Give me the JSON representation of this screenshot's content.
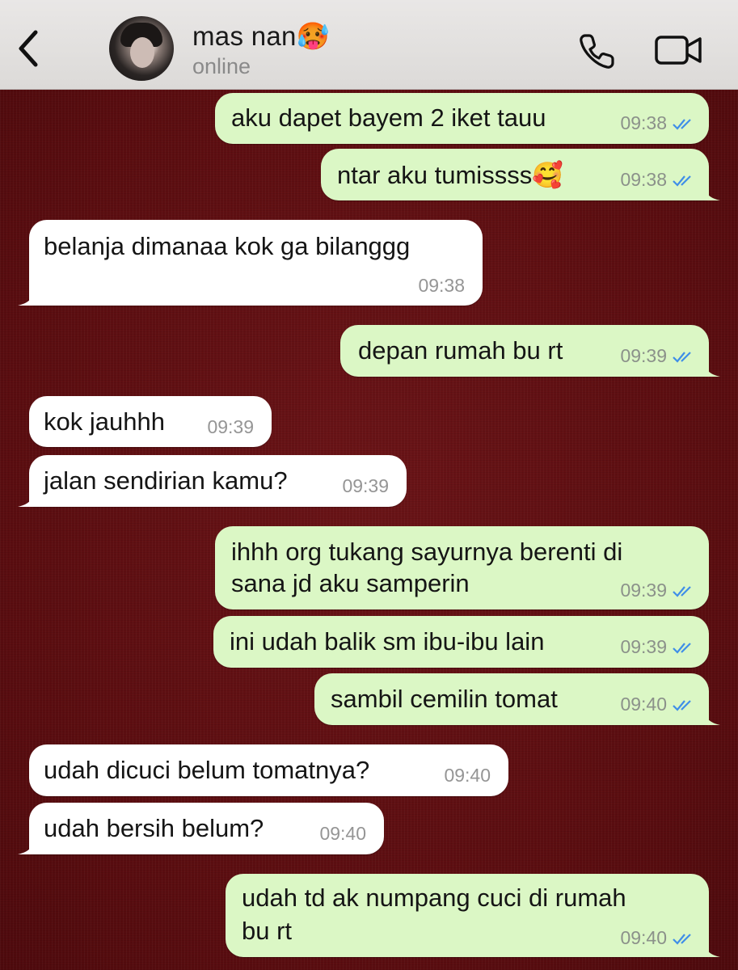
{
  "header": {
    "contact_name": "mas nan🥵",
    "status": "online"
  },
  "messages": [
    {
      "side": "out",
      "text": "aku dapet bayem 2 iket tauu",
      "time": "09:38"
    },
    {
      "side": "out",
      "text": "ntar aku tumissss🥰",
      "time": "09:38"
    },
    {
      "side": "in",
      "text": "belanja dimanaa kok ga bilanggg",
      "time": "09:38"
    },
    {
      "side": "out",
      "text": "depan rumah bu rt",
      "time": "09:39"
    },
    {
      "side": "in",
      "text": "kok jauhhh",
      "time": "09:39"
    },
    {
      "side": "in",
      "text": "jalan sendirian kamu?",
      "time": "09:39"
    },
    {
      "side": "out",
      "lines": [
        "ihhh org tukang sayurnya berenti di",
        "sana jd aku samperin"
      ],
      "time": "09:39"
    },
    {
      "side": "out",
      "text": "ini udah balik sm ibu-ibu lain",
      "time": "09:39"
    },
    {
      "side": "out",
      "text": "sambil cemilin tomat",
      "time": "09:40"
    },
    {
      "side": "in",
      "text": "udah dicuci belum tomatnya?",
      "time": "09:40"
    },
    {
      "side": "in",
      "text": "udah bersih belum?",
      "time": "09:40"
    },
    {
      "side": "out",
      "lines": [
        "udah td ak numpang cuci di rumah",
        "bu rt"
      ],
      "time": "09:40"
    }
  ],
  "colors": {
    "outgoing_bubble": "#dbf7c5",
    "incoming_bubble": "#ffffff",
    "read_ticks": "#3f8ee8",
    "chat_background": "#5e0f12"
  },
  "icons": {
    "back": "chevron-left-icon",
    "call": "phone-icon",
    "video": "video-camera-icon",
    "read_receipt": "double-check-icon"
  }
}
